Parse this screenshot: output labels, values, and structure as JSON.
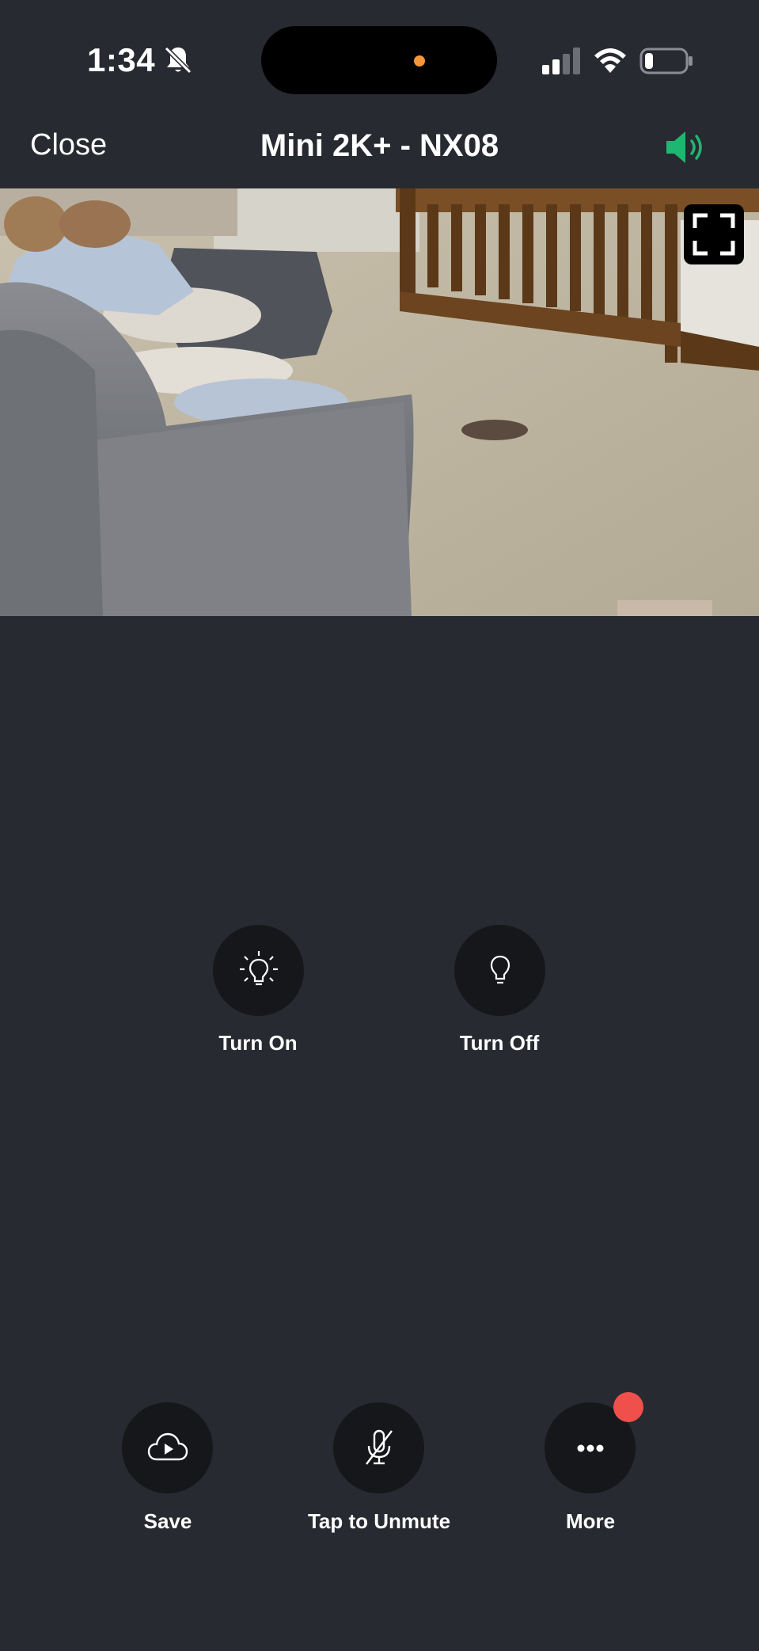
{
  "status_bar": {
    "time": "1:34",
    "battery_level": 0.2,
    "indicator_color": "#f6953a"
  },
  "nav": {
    "close_label": "Close",
    "title": "Mini 2K+ - NX08",
    "speaker_color": "#1fb671"
  },
  "video": {
    "icons": [
      "fullscreen-icon"
    ]
  },
  "light_controls": [
    {
      "label": "Turn On",
      "icon": "bulb-on-icon"
    },
    {
      "label": "Turn Off",
      "icon": "bulb-off-icon"
    }
  ],
  "bottom_controls": [
    {
      "label": "Save",
      "icon": "cloud-play-icon"
    },
    {
      "label": "Tap to Unmute",
      "icon": "mic-muted-icon"
    },
    {
      "label": "More",
      "icon": "more-dots-icon",
      "badge_color": "#f0504c"
    }
  ]
}
